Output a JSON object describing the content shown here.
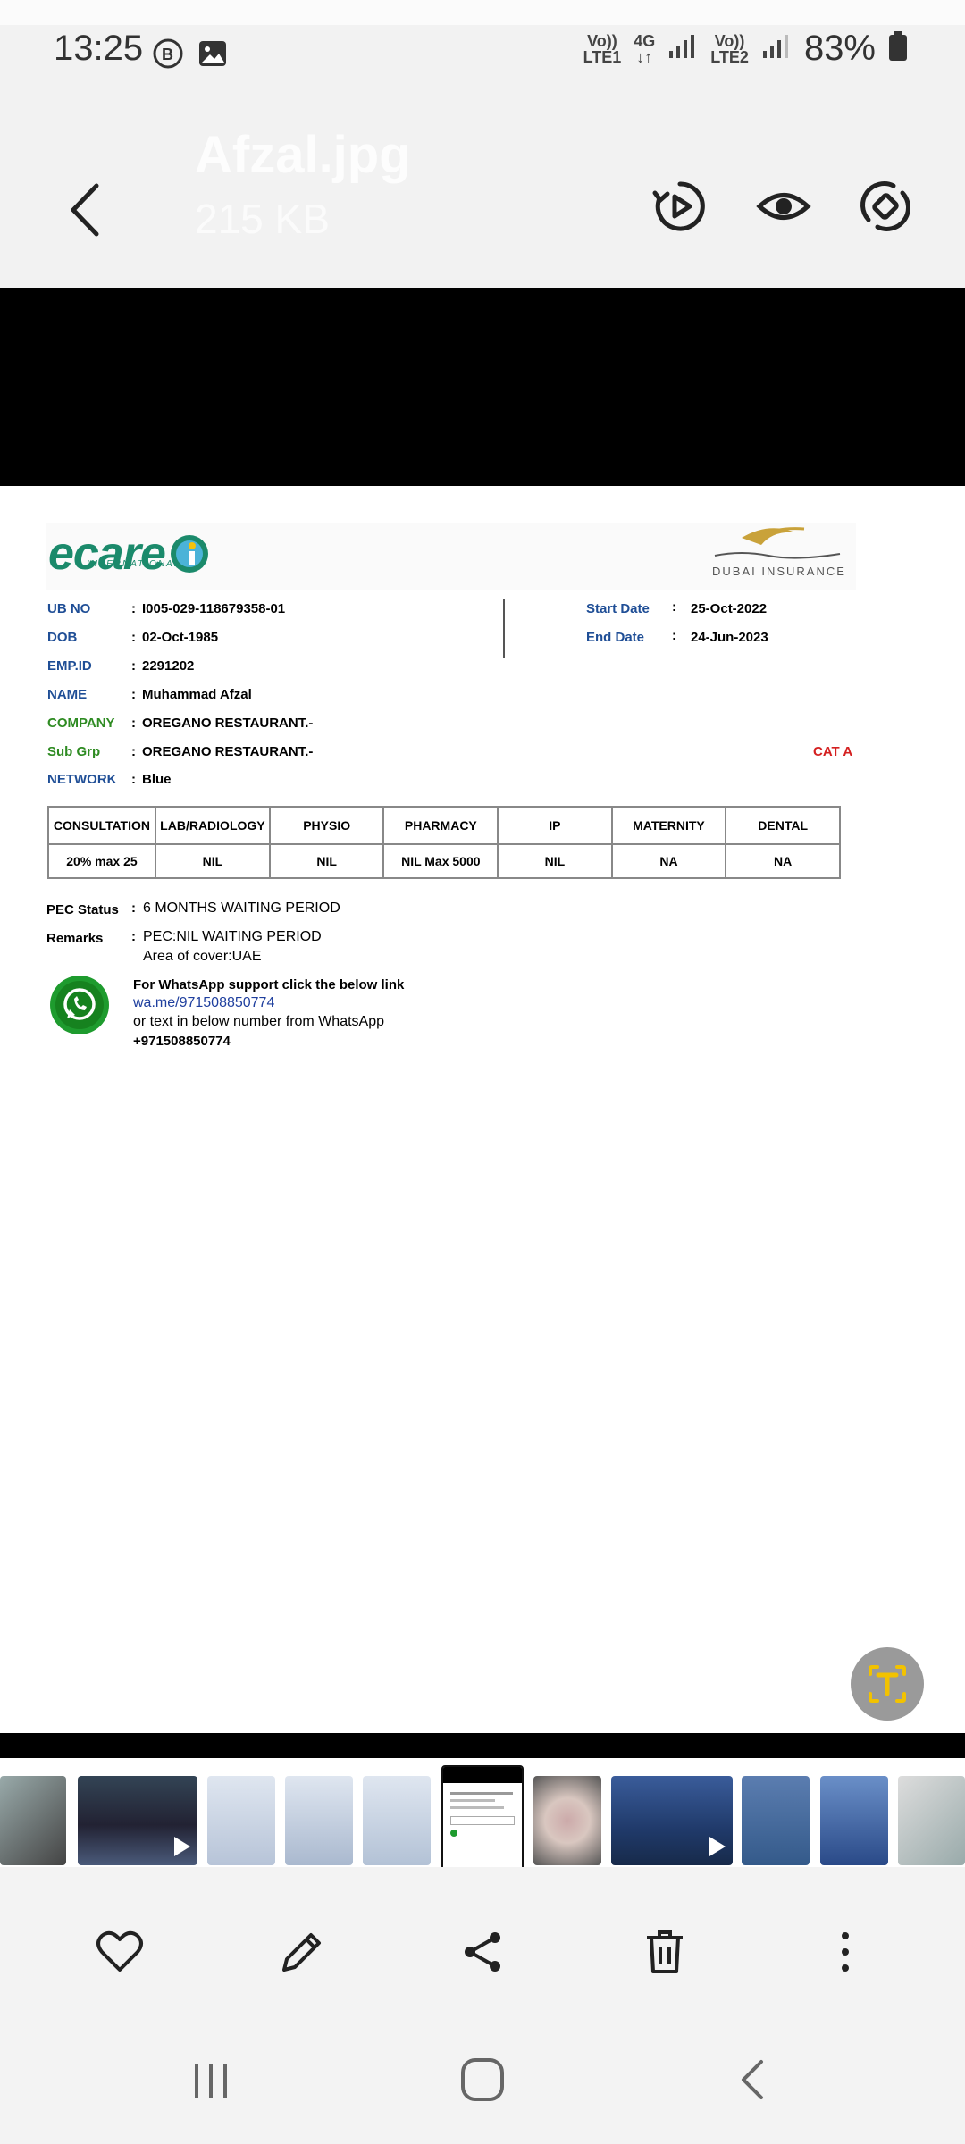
{
  "status_bar": {
    "time": "13:25",
    "lte1": "Vo)) 4G\nLTE1",
    "lte1_a": "Vo))",
    "lte1_b": "LTE1",
    "net": "4G",
    "lte2_a": "Vo))",
    "lte2_b": "LTE2",
    "battery": "83%",
    "icons": [
      "b-badge-icon",
      "image-icon"
    ]
  },
  "header": {
    "title": "Afzal.jpg",
    "file_size": "215 KB",
    "actions": [
      "play-icon",
      "eye-icon",
      "rotate-icon"
    ]
  },
  "document": {
    "logo_left": "ecare",
    "logo_left_sub": "INTERNATIONAL",
    "logo_right": "DUBAI INSURANCE",
    "fields_left": [
      {
        "label": "UB NO",
        "value": "I005-029-118679358-01",
        "color": "#1f4e96"
      },
      {
        "label": "DOB",
        "value": "02-Oct-1985",
        "color": "#1f4e96"
      },
      {
        "label": "EMP.ID",
        "value": "2291202",
        "color": "#1f4e96"
      },
      {
        "label": "NAME",
        "value": "Muhammad Afzal",
        "color": "#1f4e96"
      },
      {
        "label": "COMPANY",
        "value": "OREGANO RESTAURANT.-",
        "color": "#2e8b22"
      },
      {
        "label": "Sub Grp",
        "value": "OREGANO RESTAURANT.-",
        "color": "#2e8b22"
      },
      {
        "label": "NETWORK",
        "value": "Blue",
        "color": "#1f4e96"
      }
    ],
    "fields_right": [
      {
        "label": "Start Date",
        "value": "25-Oct-2022"
      },
      {
        "label": "End Date",
        "value": "24-Jun-2023"
      }
    ],
    "category": "CAT A",
    "benefits": {
      "headers": [
        "CONSULTATION",
        "LAB/RADIOLOGY",
        "PHYSIO",
        "PHARMACY",
        "IP",
        "MATERNITY",
        "DENTAL"
      ],
      "values": [
        "20% max 25",
        "NIL",
        "NIL",
        "NIL Max 5000",
        "NIL",
        "NA",
        "NA"
      ]
    },
    "pec_status_label": "PEC Status",
    "pec_status_value": "6 MONTHS WAITING PERIOD",
    "remarks_label": "Remarks",
    "remarks_line1": "PEC:NIL WAITING PERIOD",
    "remarks_line2": "Area of cover:UAE",
    "whatsapp": {
      "title": "For WhatsApp support click the below link",
      "link": "wa.me/971508850774",
      "text": "or text in below number from WhatsApp",
      "number": "+971508850774"
    }
  },
  "colors": {
    "accent_blue": "#1f4e96",
    "accent_green": "#2e8b22",
    "cat_red": "#d42020",
    "whatsapp_green": "#1e9b2e",
    "fab_yellow": "#f2c200"
  },
  "actionbar": [
    "heart-icon",
    "pencil-icon",
    "share-icon",
    "trash-icon",
    "more-icon"
  ],
  "navbar": [
    "recent-apps-icon",
    "home-icon",
    "back-icon"
  ]
}
